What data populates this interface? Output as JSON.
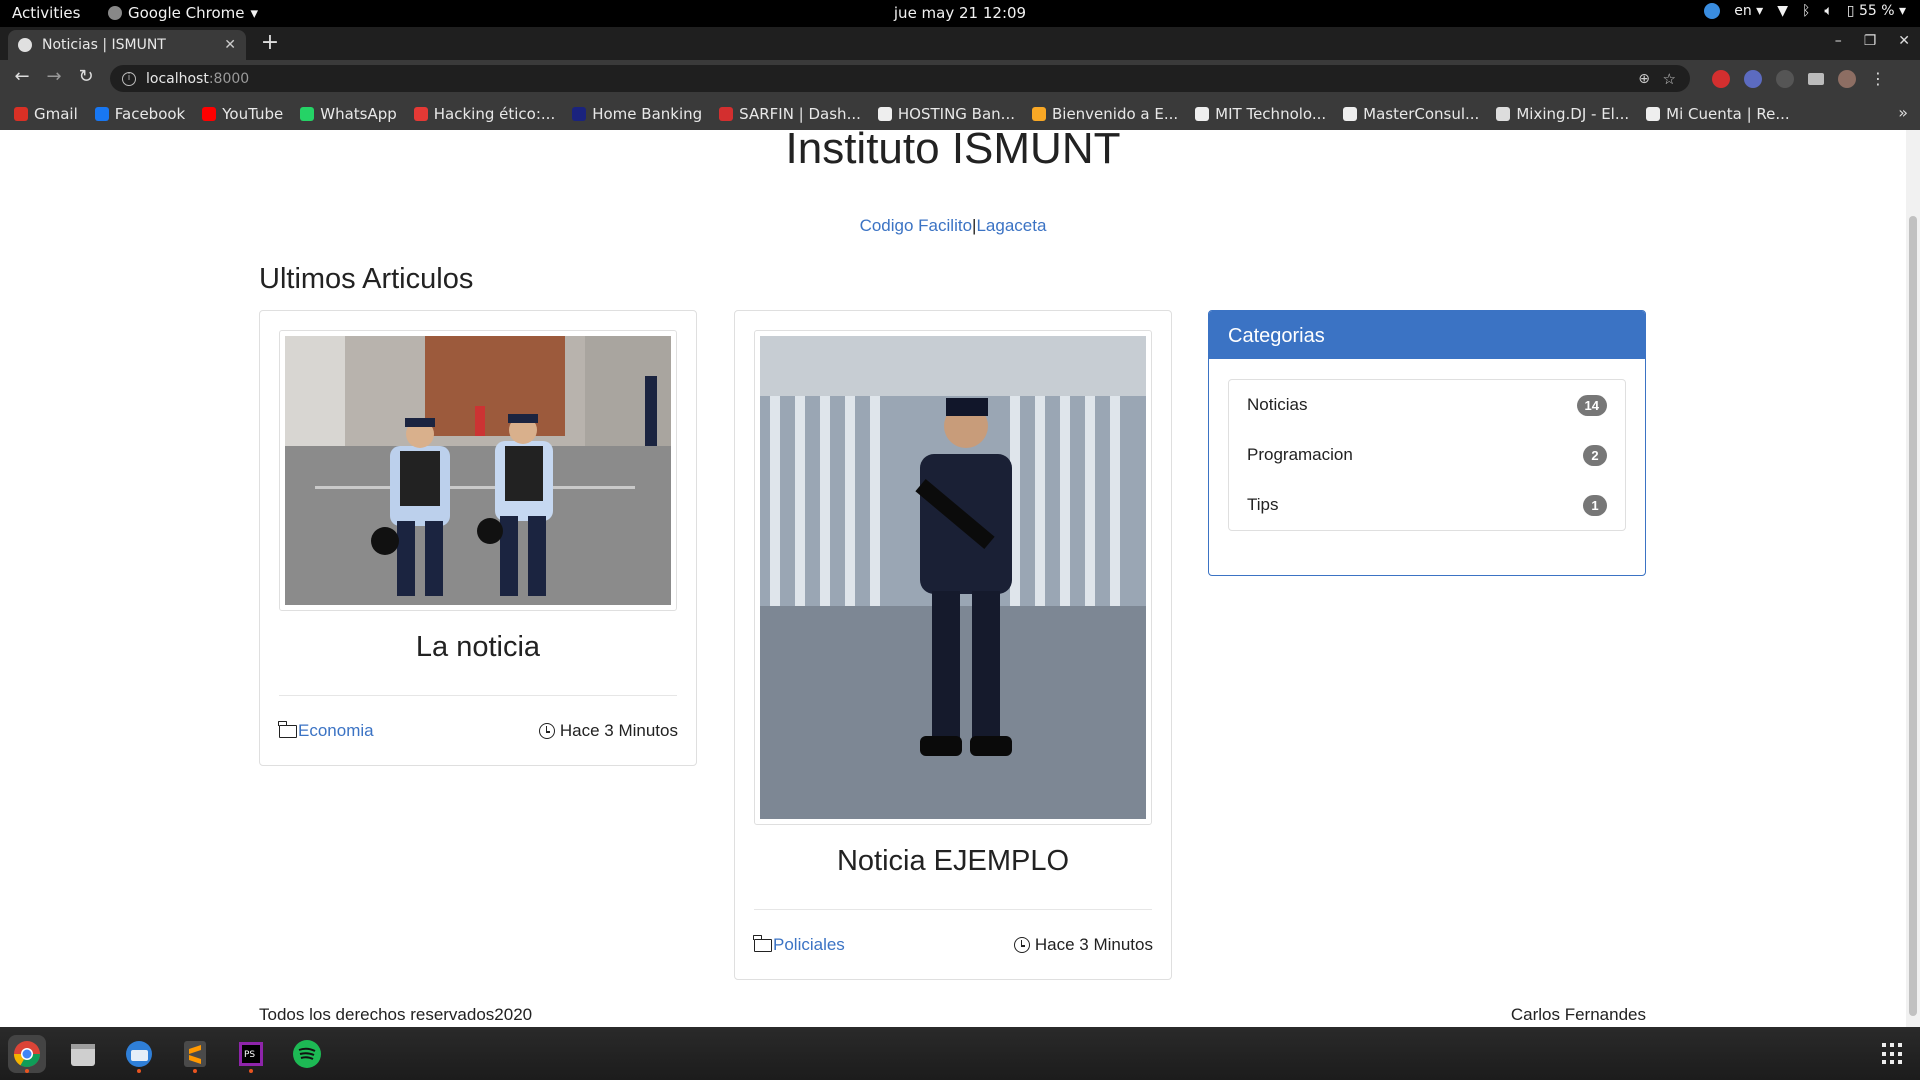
{
  "os_bar": {
    "activities": "Activities",
    "app_menu": "Google Chrome",
    "clock": "jue may 21  12:09",
    "lang": "en",
    "battery": "55 %"
  },
  "browser": {
    "tab_title": "Noticias | ISMUNT",
    "url_host": "localhost",
    "url_port": ":8000",
    "bookmarks": [
      {
        "label": "Gmail",
        "color": "#d93025"
      },
      {
        "label": "Facebook",
        "color": "#1877f2"
      },
      {
        "label": "YouTube",
        "color": "#ff0000"
      },
      {
        "label": "WhatsApp",
        "color": "#25d366"
      },
      {
        "label": "Hacking ético:...",
        "color": "#e53935"
      },
      {
        "label": "Home Banking",
        "color": "#1a237e"
      },
      {
        "label": "SARFIN | Dash...",
        "color": "#d32f2f"
      },
      {
        "label": "HOSTING Ban...",
        "color": "#eeeeee"
      },
      {
        "label": "Bienvenido a E...",
        "color": "#f9a825"
      },
      {
        "label": "MIT Technolo...",
        "color": "#eeeeee"
      },
      {
        "label": "MasterConsul...",
        "color": "#eeeeee"
      },
      {
        "label": "Mixing.DJ - El...",
        "color": "#dddddd"
      },
      {
        "label": "Mi Cuenta | Re...",
        "color": "#eeeeee"
      }
    ]
  },
  "site": {
    "title": "Instituto ISMUNT",
    "links": [
      {
        "label": "Codigo Facilito"
      },
      {
        "separator": "|"
      },
      {
        "label": "Lagaceta"
      }
    ],
    "section_title": "Ultimos Articulos",
    "articles": [
      {
        "title": "La noticia",
        "category": "Economia",
        "time": "Hace 3 Minutos"
      },
      {
        "title": "Noticia EJEMPLO",
        "category": "Policiales",
        "time": "Hace 3 Minutos"
      }
    ],
    "sidebar": {
      "heading": "Categorias",
      "categories": [
        {
          "name": "Noticias",
          "count": "14"
        },
        {
          "name": "Programacion",
          "count": "2"
        },
        {
          "name": "Tips",
          "count": "1"
        }
      ]
    },
    "footer": {
      "left": "Todos los derechos reservados2020",
      "right": "Carlos Fernandes"
    }
  },
  "colors": {
    "link": "#3b73c4",
    "panel_header": "#3b73c4",
    "badge": "#777777"
  }
}
